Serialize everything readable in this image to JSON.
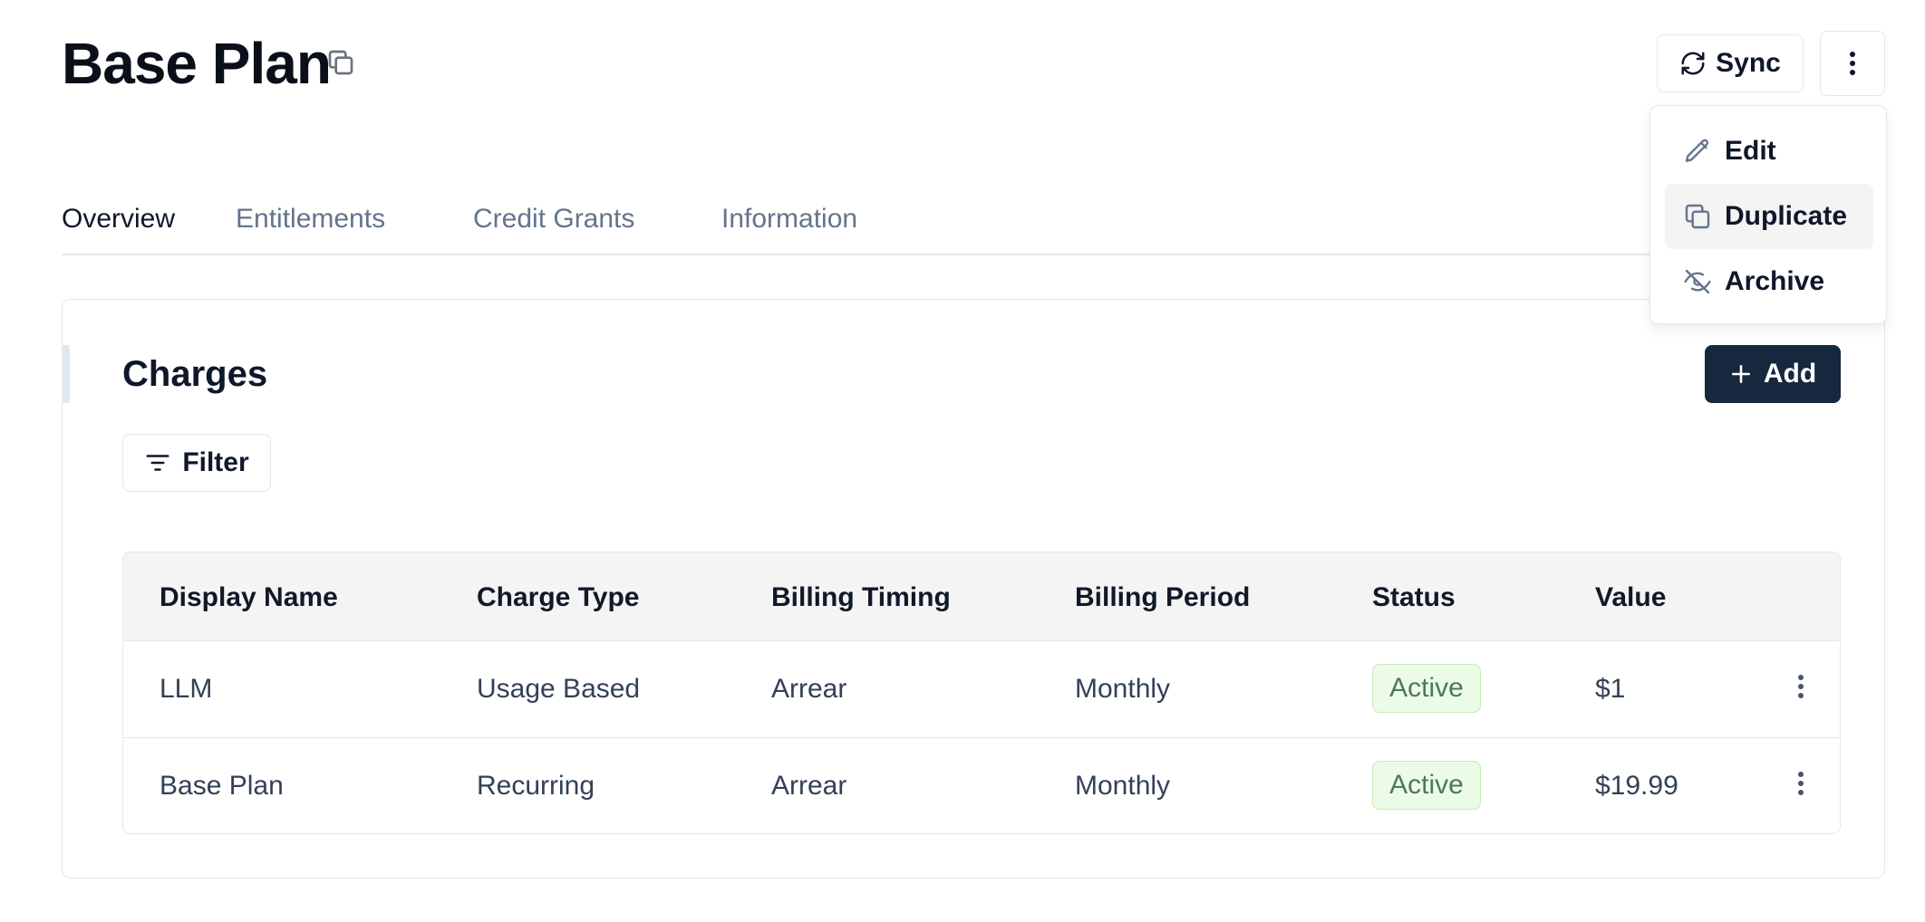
{
  "header": {
    "title": "Base Plan",
    "sync_label": "Sync"
  },
  "tabs": [
    {
      "label": "Overview",
      "active": true
    },
    {
      "label": "Entitlements",
      "active": false
    },
    {
      "label": "Credit Grants",
      "active": false
    },
    {
      "label": "Information",
      "active": false
    }
  ],
  "charges": {
    "title": "Charges",
    "add_label": "Add",
    "filter_label": "Filter",
    "columns": [
      "Display Name",
      "Charge Type",
      "Billing Timing",
      "Billing Period",
      "Status",
      "Value"
    ],
    "rows": [
      {
        "display_name": "LLM",
        "charge_type": "Usage Based",
        "billing_timing": "Arrear",
        "billing_period": "Monthly",
        "status": "Active",
        "value": "$1"
      },
      {
        "display_name": "Base Plan",
        "charge_type": "Recurring",
        "billing_timing": "Arrear",
        "billing_period": "Monthly",
        "status": "Active",
        "value": "$19.99"
      }
    ]
  },
  "menu": {
    "items": [
      {
        "label": "Edit",
        "icon": "pencil-icon"
      },
      {
        "label": "Duplicate",
        "icon": "copy-icon",
        "highlighted": true
      },
      {
        "label": "Archive",
        "icon": "eye-off-icon"
      }
    ]
  },
  "colors": {
    "primary_button": "#15283d",
    "status_active_bg": "#ecfbe6",
    "status_active_text": "#4b7a55",
    "muted_text": "#64748b"
  }
}
